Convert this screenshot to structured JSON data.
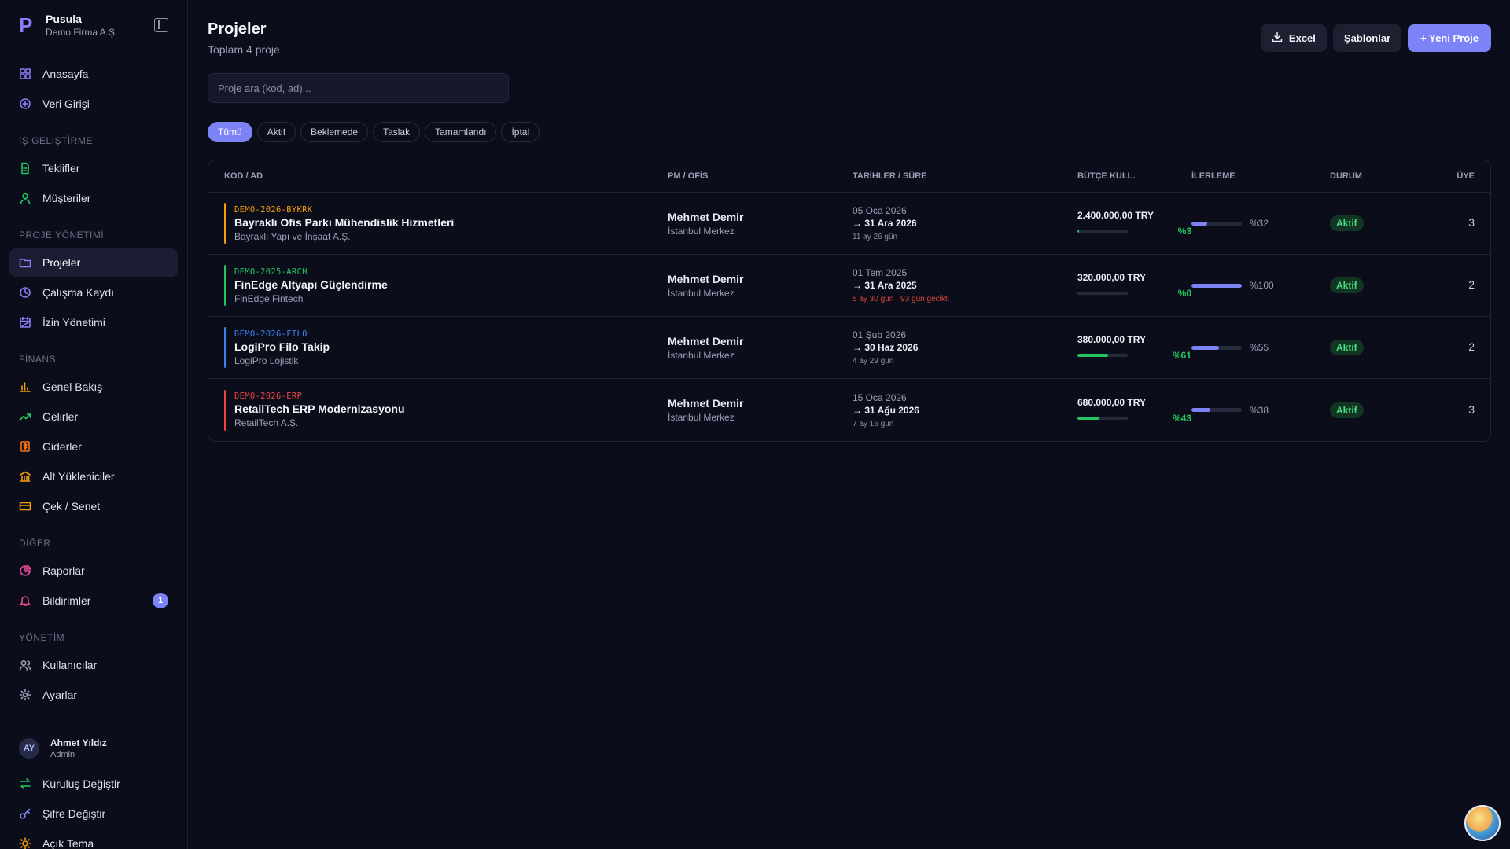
{
  "brand": {
    "name": "Pusula",
    "company": "Demo Firma A.Ş."
  },
  "nav": {
    "top": [
      {
        "label": "Anasayfa",
        "icon": "grid-icon"
      },
      {
        "label": "Veri Girişi",
        "icon": "plus-circle-icon"
      }
    ],
    "sections": [
      {
        "title": "İŞ GELİŞTİRME",
        "items": [
          {
            "label": "Teklifler",
            "icon": "file-icon",
            "color": "#22c55e"
          },
          {
            "label": "Müşteriler",
            "icon": "user-icon",
            "color": "#22c55e"
          }
        ]
      },
      {
        "title": "PROJE YÖNETİMİ",
        "items": [
          {
            "label": "Projeler",
            "icon": "folder-icon",
            "color": "#8b7cf6",
            "active": true
          },
          {
            "label": "Çalışma Kaydı",
            "icon": "clock-icon",
            "color": "#8b7cf6"
          },
          {
            "label": "İzin Yönetimi",
            "icon": "calendar-icon",
            "color": "#8b7cf6"
          }
        ]
      },
      {
        "title": "FİNANS",
        "items": [
          {
            "label": "Genel Bakış",
            "icon": "bar-chart-icon",
            "color": "#f59e0b"
          },
          {
            "label": "Gelirler",
            "icon": "trend-up-icon",
            "color": "#22c55e"
          },
          {
            "label": "Giderler",
            "icon": "receipt-icon",
            "color": "#f97316"
          },
          {
            "label": "Alt Yükleniciler",
            "icon": "bank-icon",
            "color": "#f59e0b"
          },
          {
            "label": "Çek / Senet",
            "icon": "card-icon",
            "color": "#f59e0b"
          }
        ]
      },
      {
        "title": "DİĞER",
        "items": [
          {
            "label": "Raporlar",
            "icon": "pie-icon",
            "color": "#ec4899"
          },
          {
            "label": "Bildirimler",
            "icon": "bell-icon",
            "color": "#ec4899",
            "badge": "1"
          }
        ]
      },
      {
        "title": "YÖNETİM",
        "items": [
          {
            "label": "Kullanıcılar",
            "icon": "users-icon",
            "color": "#9aa0b8"
          },
          {
            "label": "Ayarlar",
            "icon": "gear-icon",
            "color": "#9aa0b8"
          }
        ]
      }
    ]
  },
  "user": {
    "initials": "AY",
    "name": "Ahmet Yıldız",
    "role": "Admin"
  },
  "footer_items": [
    {
      "label": "Kuruluş Değiştir",
      "icon": "swap-icon",
      "color": "#22c55e"
    },
    {
      "label": "Şifre Değiştir",
      "icon": "key-icon",
      "color": "#7c83f6"
    },
    {
      "label": "Açık Tema",
      "icon": "sun-icon",
      "color": "#f59e0b"
    }
  ],
  "page": {
    "title": "Projeler",
    "subtitle": "Toplam 4 proje"
  },
  "actions": {
    "excel": "Excel",
    "templates": "Şablonlar",
    "new_project": "+ Yeni Proje"
  },
  "search": {
    "placeholder": "Proje ara (kod, ad)..."
  },
  "filters": [
    "Tümü",
    "Aktif",
    "Beklemede",
    "Taslak",
    "Tamamlandı",
    "İptal"
  ],
  "table": {
    "headers": [
      "KOD / AD",
      "PM / OFİS",
      "TARİHLER / SÜRE",
      "BÜTÇE KULL.",
      "İLERLEME",
      "DURUM",
      "ÜYE"
    ],
    "rows": [
      {
        "code": "DEMO-2026-BYKRK",
        "color": "#f59e0b",
        "name": "Bayraklı Ofis Parkı Mühendislik Hizmetleri",
        "client": "Bayraklı Yapı ve İnşaat A.Ş.",
        "pm": "Mehmet Demir",
        "office": "İstanbul Merkez",
        "start": "05 Oca 2026",
        "end": "→ 31 Ara 2026",
        "duration": "11 ay 26 gün",
        "late": false,
        "budget": "2.400.000,00 TRY",
        "budget_used": 3,
        "budget_pct": "%3",
        "progress": 32,
        "progress_pct": "%32",
        "status": "Aktif",
        "members": "3"
      },
      {
        "code": "DEMO-2025-ARCH",
        "color": "#22c55e",
        "name": "FinEdge Altyapı Güçlendirme",
        "client": "FinEdge Fintech",
        "pm": "Mehmet Demir",
        "office": "İstanbul Merkez",
        "start": "01 Tem 2025",
        "end": "→ 31 Ara 2025",
        "duration": "5 ay 30 gün · 93 gün gecikti",
        "late": true,
        "budget": "320.000,00 TRY",
        "budget_used": 0,
        "budget_pct": "%0",
        "progress": 100,
        "progress_pct": "%100",
        "status": "Aktif",
        "members": "2"
      },
      {
        "code": "DEMO-2026-FILO",
        "color": "#3b82f6",
        "name": "LogiPro Filo Takip",
        "client": "LogiPro Lojistik",
        "pm": "Mehmet Demir",
        "office": "İstanbul Merkez",
        "start": "01 Şub 2026",
        "end": "→ 30 Haz 2026",
        "duration": "4 ay 29 gün",
        "late": false,
        "budget": "380.000,00 TRY",
        "budget_used": 61,
        "budget_pct": "%61",
        "progress": 55,
        "progress_pct": "%55",
        "status": "Aktif",
        "members": "2"
      },
      {
        "code": "DEMO-2026-ERP",
        "color": "#ef4444",
        "name": "RetailTech ERP Modernizasyonu",
        "client": "RetailTech A.Ş.",
        "pm": "Mehmet Demir",
        "office": "İstanbul Merkez",
        "start": "15 Oca 2026",
        "end": "→ 31 Ağu 2026",
        "duration": "7 ay 16 gün",
        "late": false,
        "budget": "680.000,00 TRY",
        "budget_used": 43,
        "budget_pct": "%43",
        "progress": 38,
        "progress_pct": "%38",
        "status": "Aktif",
        "members": "3"
      }
    ]
  },
  "colors": {
    "accent": "#7c83f6",
    "background": "#0b0d1a",
    "success": "#22c55e"
  }
}
